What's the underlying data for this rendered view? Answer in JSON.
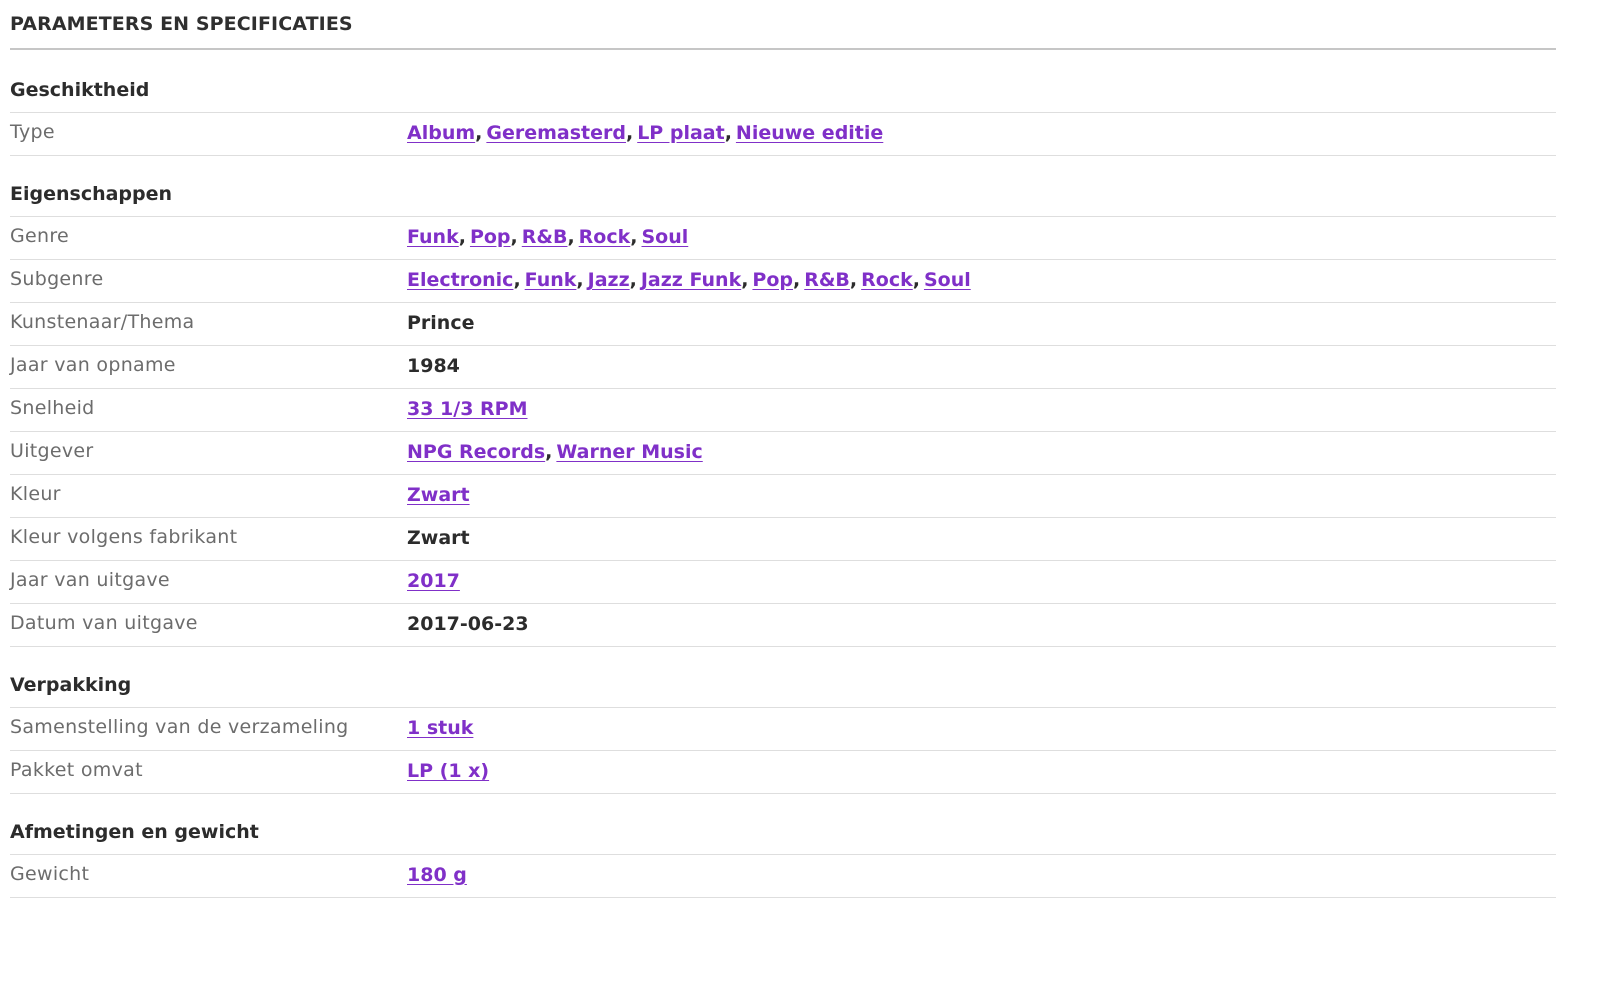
{
  "title": "PARAMETERS EN SPECIFICATIES",
  "colors": {
    "link": "#8030c8",
    "label": "#6c6c6c",
    "text": "#2c2c2c",
    "divider": "#dedede"
  },
  "sections": [
    {
      "title": "Geschiktheid",
      "rows": [
        {
          "label": "Type",
          "links": [
            "Album",
            "Geremasterd",
            "LP plaat",
            "Nieuwe editie"
          ]
        }
      ]
    },
    {
      "title": "Eigenschappen",
      "rows": [
        {
          "label": "Genre",
          "links": [
            "Funk",
            "Pop",
            "R&B",
            "Rock",
            "Soul"
          ]
        },
        {
          "label": "Subgenre",
          "links": [
            "Electronic",
            "Funk",
            "Jazz",
            "Jazz Funk",
            "Pop",
            "R&B",
            "Rock",
            "Soul"
          ]
        },
        {
          "label": "Kunstenaar/Thema",
          "text": "Prince"
        },
        {
          "label": "Jaar van opname",
          "text": "1984"
        },
        {
          "label": "Snelheid",
          "links": [
            "33 1/3 RPM"
          ]
        },
        {
          "label": "Uitgever",
          "links": [
            "NPG Records",
            "Warner Music"
          ]
        },
        {
          "label": "Kleur",
          "links": [
            "Zwart"
          ]
        },
        {
          "label": "Kleur volgens fabrikant",
          "text": "Zwart"
        },
        {
          "label": "Jaar van uitgave",
          "links": [
            "2017"
          ]
        },
        {
          "label": "Datum van uitgave",
          "text": "2017-06-23"
        }
      ]
    },
    {
      "title": "Verpakking",
      "rows": [
        {
          "label": "Samenstelling van de verzameling",
          "links": [
            "1 stuk"
          ]
        },
        {
          "label": "Pakket omvat",
          "links": [
            "LP (1 x)"
          ]
        }
      ]
    },
    {
      "title": "Afmetingen en gewicht",
      "rows": [
        {
          "label": "Gewicht",
          "links": [
            "180 g"
          ]
        }
      ]
    }
  ]
}
